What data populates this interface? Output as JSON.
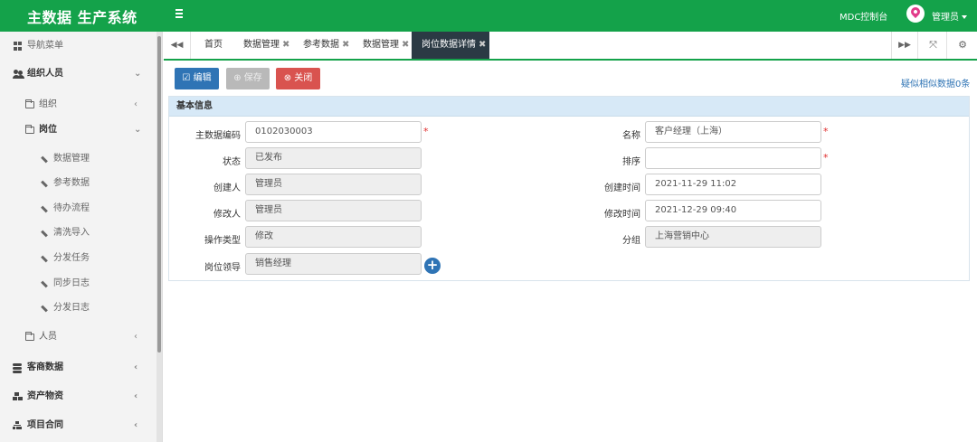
{
  "app": {
    "title": "主数据 生产系统"
  },
  "header": {
    "console": "MDC控制台",
    "user": "管理员"
  },
  "sidebar": {
    "nav_title": "导航菜单",
    "groups": {
      "org": "组织人员",
      "org_unit": "组织",
      "position": "岗位",
      "person": "人员",
      "customer": "客商数据",
      "assets": "资产物资",
      "contract": "项目合同"
    },
    "leaves": [
      "数据管理",
      "参考数据",
      "待办流程",
      "清洗导入",
      "分发任务",
      "同步日志",
      "分发日志"
    ]
  },
  "tabs": [
    {
      "label": "首页",
      "closable": false
    },
    {
      "label": "数据管理",
      "closable": true
    },
    {
      "label": "参考数据",
      "closable": true
    },
    {
      "label": "数据管理",
      "closable": true
    },
    {
      "label": "岗位数据详情",
      "closable": true,
      "active": true
    }
  ],
  "toolbar": {
    "edit": "编辑",
    "save": "保存",
    "close": "关闭",
    "similar": "疑似相似数据0条"
  },
  "panel": {
    "title": "基本信息"
  },
  "form": {
    "code_label": "主数据编码",
    "code_value": "0102030003",
    "status_label": "状态",
    "status_value": "已发布",
    "creator_label": "创建人",
    "creator_value": "管理员",
    "modifier_label": "修改人",
    "modifier_value": "管理员",
    "optype_label": "操作类型",
    "optype_value": "修改",
    "leader_label": "岗位领导",
    "leader_value": "销售经理",
    "name_label": "名称",
    "name_value": "客户经理（上海）",
    "sort_label": "排序",
    "sort_value": "",
    "ctime_label": "创建时间",
    "ctime_value": "2021-11-29 11:02",
    "mtime_label": "修改时间",
    "mtime_value": "2021-12-29 09:40",
    "group_label": "分组",
    "group_value": "上海营销中心"
  },
  "colors": {
    "brand": "#14a24a",
    "primary": "#2f74b5",
    "danger": "#d9534f",
    "panel_head": "#d7e9f7"
  },
  "icons": {
    "nav": "grid-icon",
    "org": "users-icon",
    "folder": "folder-icon",
    "leaf": "pencil-icon",
    "customer": "database-icon",
    "assets": "cubes-icon",
    "contract": "sitemap-icon"
  }
}
